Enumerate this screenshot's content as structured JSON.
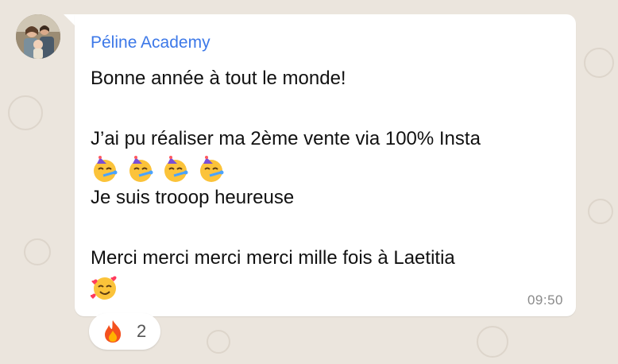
{
  "chat": {
    "sender": "Péline Academy",
    "lines": {
      "l1": "Bonne année à tout le monde!",
      "l2": "J’ai pu réaliser ma 2ème vente via 100% Insta",
      "l3": "Je suis trooop heureuse",
      "l4": "Merci merci merci merci mille fois à Laetitia"
    },
    "emoji_rows": {
      "party_faces": [
        "partying-face",
        "partying-face",
        "partying-face",
        "partying-face"
      ],
      "love_face": "smiling-face-with-hearts"
    },
    "time": "09:50"
  },
  "reaction": {
    "emoji": "fire",
    "count": "2"
  },
  "colors": {
    "sender_name": "#3c78e8",
    "bubble_bg": "#ffffff",
    "wallpaper": "#ebe5dd",
    "time_text": "#8a8a8a"
  }
}
